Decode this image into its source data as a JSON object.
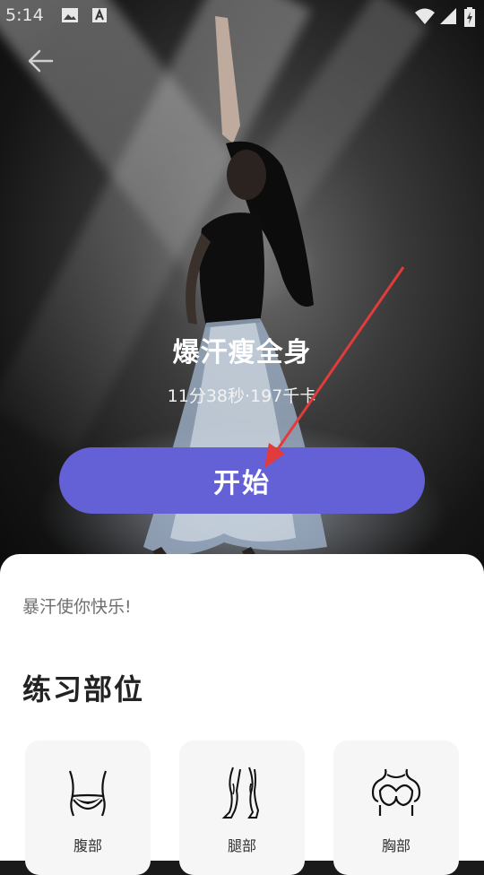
{
  "status_bar": {
    "time": "5:14"
  },
  "workout": {
    "title": "爆汗瘦全身",
    "meta": "11分38秒·197千卡",
    "start_label": "开始"
  },
  "sheet": {
    "slogan": "暴汗使你快乐!",
    "section_title": "练习部位",
    "parts": [
      {
        "label": "腹部",
        "icon": "abdomen-icon"
      },
      {
        "label": "腿部",
        "icon": "legs-icon"
      },
      {
        "label": "胸部",
        "icon": "chest-icon"
      }
    ]
  },
  "colors": {
    "accent": "#6461d7",
    "annotation": "#e23b3b"
  }
}
